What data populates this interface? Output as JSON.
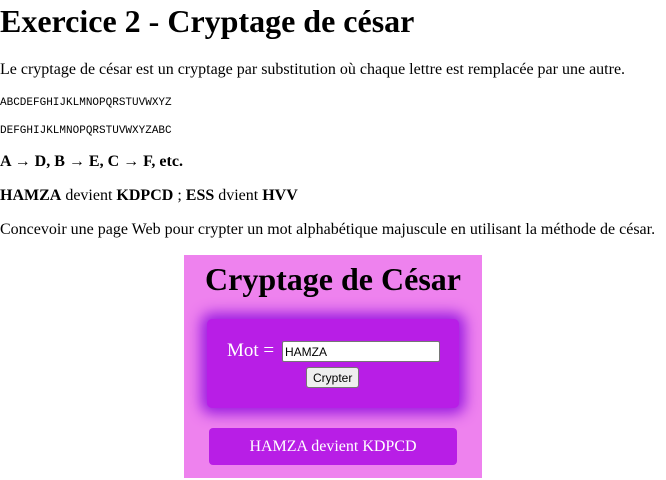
{
  "heading": "Exercice 2 - Cryptage de césar",
  "intro": "Le cryptage de césar est un cryptage par substitution où chaque lettre est remplacée par une autre.",
  "alphabet_plain": "ABCDEFGHIJKLMNOPQRSTUVWXYZ",
  "alphabet_shifted": "DEFGHIJKLMNOPQRSTUVWXYZABC",
  "mapping_example": "A → D, B → E, C → F, etc.",
  "example": {
    "word1": "HAMZA",
    "text1": " devient ",
    "result1": "KDPCD",
    "sep": " ; ",
    "word2": "ESS",
    "text2": " dvient ",
    "result2": "HVV"
  },
  "instruction": "Concevoir une page Web pour crypter un mot alphabétique majuscule en utilisant la méthode de césar.",
  "app": {
    "title": "Cryptage de César",
    "label": "Mot =",
    "input_value": "HAMZA",
    "button_label": "Crypter",
    "result_text": "HAMZA devient KDPCD",
    "colors": {
      "card_bg": "#ee82ee",
      "box_bg": "#b81ee6"
    }
  }
}
